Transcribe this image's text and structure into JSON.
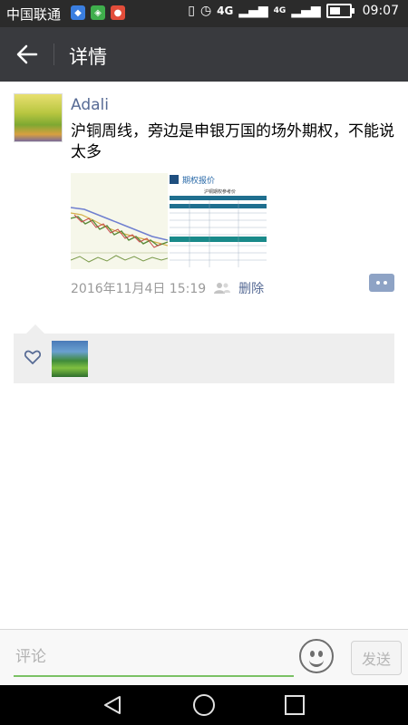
{
  "status_bar": {
    "carrier": "中国联通",
    "network": "4G",
    "network2": "4G",
    "time": "09:07",
    "battery_level": 0.7
  },
  "header": {
    "title": "详情",
    "back_icon": "arrow-left-icon"
  },
  "post": {
    "author": "Adali",
    "text": "沪铜周线，旁边是申银万国的场外期权，不能说太多",
    "timestamp": "2016年11月4日 15:19",
    "delete_label": "删除",
    "image_table_title": "期权报价",
    "image_table_subtitle": "沪铜期权参考价"
  },
  "likes": {
    "heart_icon": "heart-icon"
  },
  "comment": {
    "placeholder": "评论",
    "send_label": "发送"
  },
  "colors": {
    "title_bar": "#393a3e",
    "link": "#576b95",
    "input_underline": "#7ac165"
  }
}
